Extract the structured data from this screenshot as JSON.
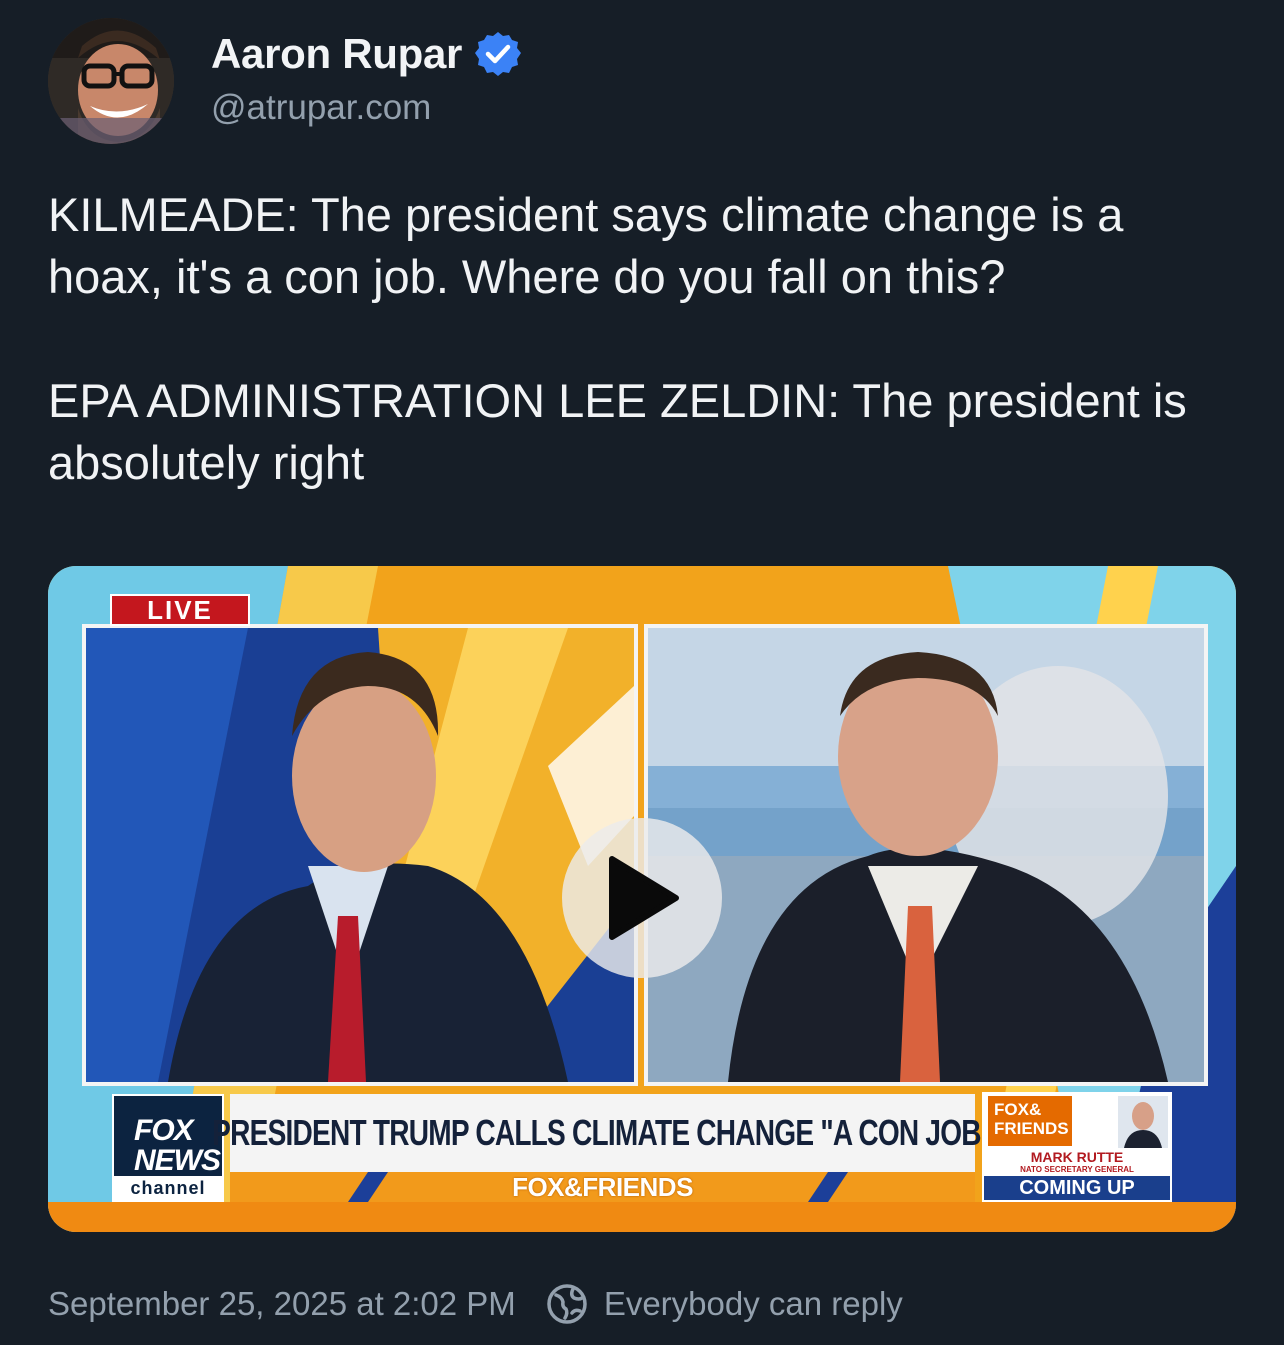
{
  "author": {
    "name": "Aaron Rupar",
    "handle": "@atrupar.com",
    "verified": true
  },
  "post": {
    "paragraphs": [
      "KILMEADE: The president says climate change is a hoax, it's a con job. Where do you fall on this?",
      "EPA ADMINISTRATION LEE ZELDIN: The president is absolutely right"
    ]
  },
  "media": {
    "type": "video",
    "live_badge": "LIVE",
    "headline": "PRESIDENT TRUMP CALLS CLIMATE CHANGE \"A CON JOB\"",
    "show_name": "FOX&FRIENDS",
    "network_logo": {
      "line1": "FOX",
      "line2": "NEWS",
      "line3": "channel"
    },
    "show_logo": {
      "line1": "FOX&",
      "line2": "FRIENDS"
    },
    "up_next": {
      "name": "MARK RUTTE",
      "title": "NATO SECRETARY GENERAL",
      "label": "COMING UP"
    }
  },
  "footer": {
    "timestamp": "September 25, 2025 at 2:02 PM",
    "reply_setting": "Everybody can reply"
  },
  "colors": {
    "background": "#161e27",
    "accent_verified": "#3b82f6",
    "secondary_text": "#93a0ad"
  },
  "icons": [
    "verified-badge-icon",
    "play-icon",
    "globe-icon"
  ]
}
